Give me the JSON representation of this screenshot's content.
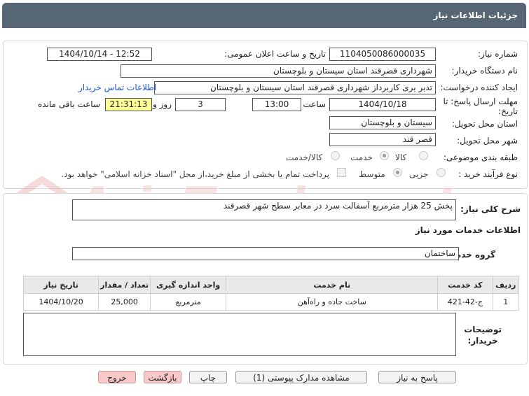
{
  "header": {
    "title": "جزئیات اطلاعات نیاز"
  },
  "watermark": {
    "text": "AriaTender.net"
  },
  "form": {
    "need_number_label": "شماره نیاز:",
    "need_number": "1104050086000035",
    "announce_label": "تاریخ و ساعت اعلان عمومی:",
    "announce_value": "1404/10/14 - 12:52",
    "buyer_org_label": "نام دستگاه خریدار:",
    "buyer_org": "شهرداری قصرقند استان سیستان و بلوچستان",
    "creator_label": "ایجاد کننده درخواست:",
    "creator": "تدبر بری کاربرداز شهرداری قصرقند استان سیستان و بلوچستان",
    "contact_link": "اطلاعات تماس خریدار",
    "deadline_label_1": "مهلت ارسال پاسخ: تا",
    "deadline_label_2": "تاریخ:",
    "deadline_date": "1404/10/18",
    "time_label": "ساعت",
    "deadline_time": "13:00",
    "days_value": "3",
    "days_label": "روز و",
    "remaining_value": "21:31:13",
    "remaining_label": "ساعت باقی مانده",
    "province_label": "استان محل تحویل:",
    "province": "سیستان و بلوچستان",
    "city_label": "شهر محل تحویل:",
    "city": "قصر قند",
    "category_label": "طبقه بندی موضوعی:",
    "category_options": [
      "کالا",
      "خدمت",
      "کالا/خدمت"
    ],
    "category_selected": "خدمت",
    "process_label": "نوع فرآیند خرید :",
    "process_options": [
      "جزیی",
      "متوسط"
    ],
    "process_selected": "متوسط",
    "payment_note": "پرداخت تمام یا بخشی از مبلغ خرید،از محل \"اسناد خزانه اسلامی\" خواهد بود."
  },
  "summary": {
    "label": "شرح کلی نیاز:",
    "value": "پخش 25 هزار مترمربع آسفالت سرد در معابر سطح شهر قصرقند"
  },
  "services": {
    "section_title": "اطلاعات خدمات مورد نیاز",
    "group_label": "گروه خدمت:",
    "group_value": "ساختمان",
    "columns": [
      "ردیف",
      "کد خدمت",
      "نام خدمت",
      "واحد اندازه گیری",
      "تعداد / مقدار",
      "تاریخ نیاز"
    ],
    "rows": [
      [
        "1",
        "ج-42-421",
        "ساخت جاده و راه‌آهن",
        "مترمربع",
        "25,000",
        "1404/10/20"
      ]
    ]
  },
  "notes": {
    "label_1": "توضیحات",
    "label_2": "خریدار:",
    "value": ""
  },
  "buttons": {
    "reply": "پاسخ به نیاز",
    "attachments": "مشاهده مدارک پیوستی (1)",
    "print": "چاپ",
    "back": "بازگشت",
    "exit": "خروج"
  }
}
